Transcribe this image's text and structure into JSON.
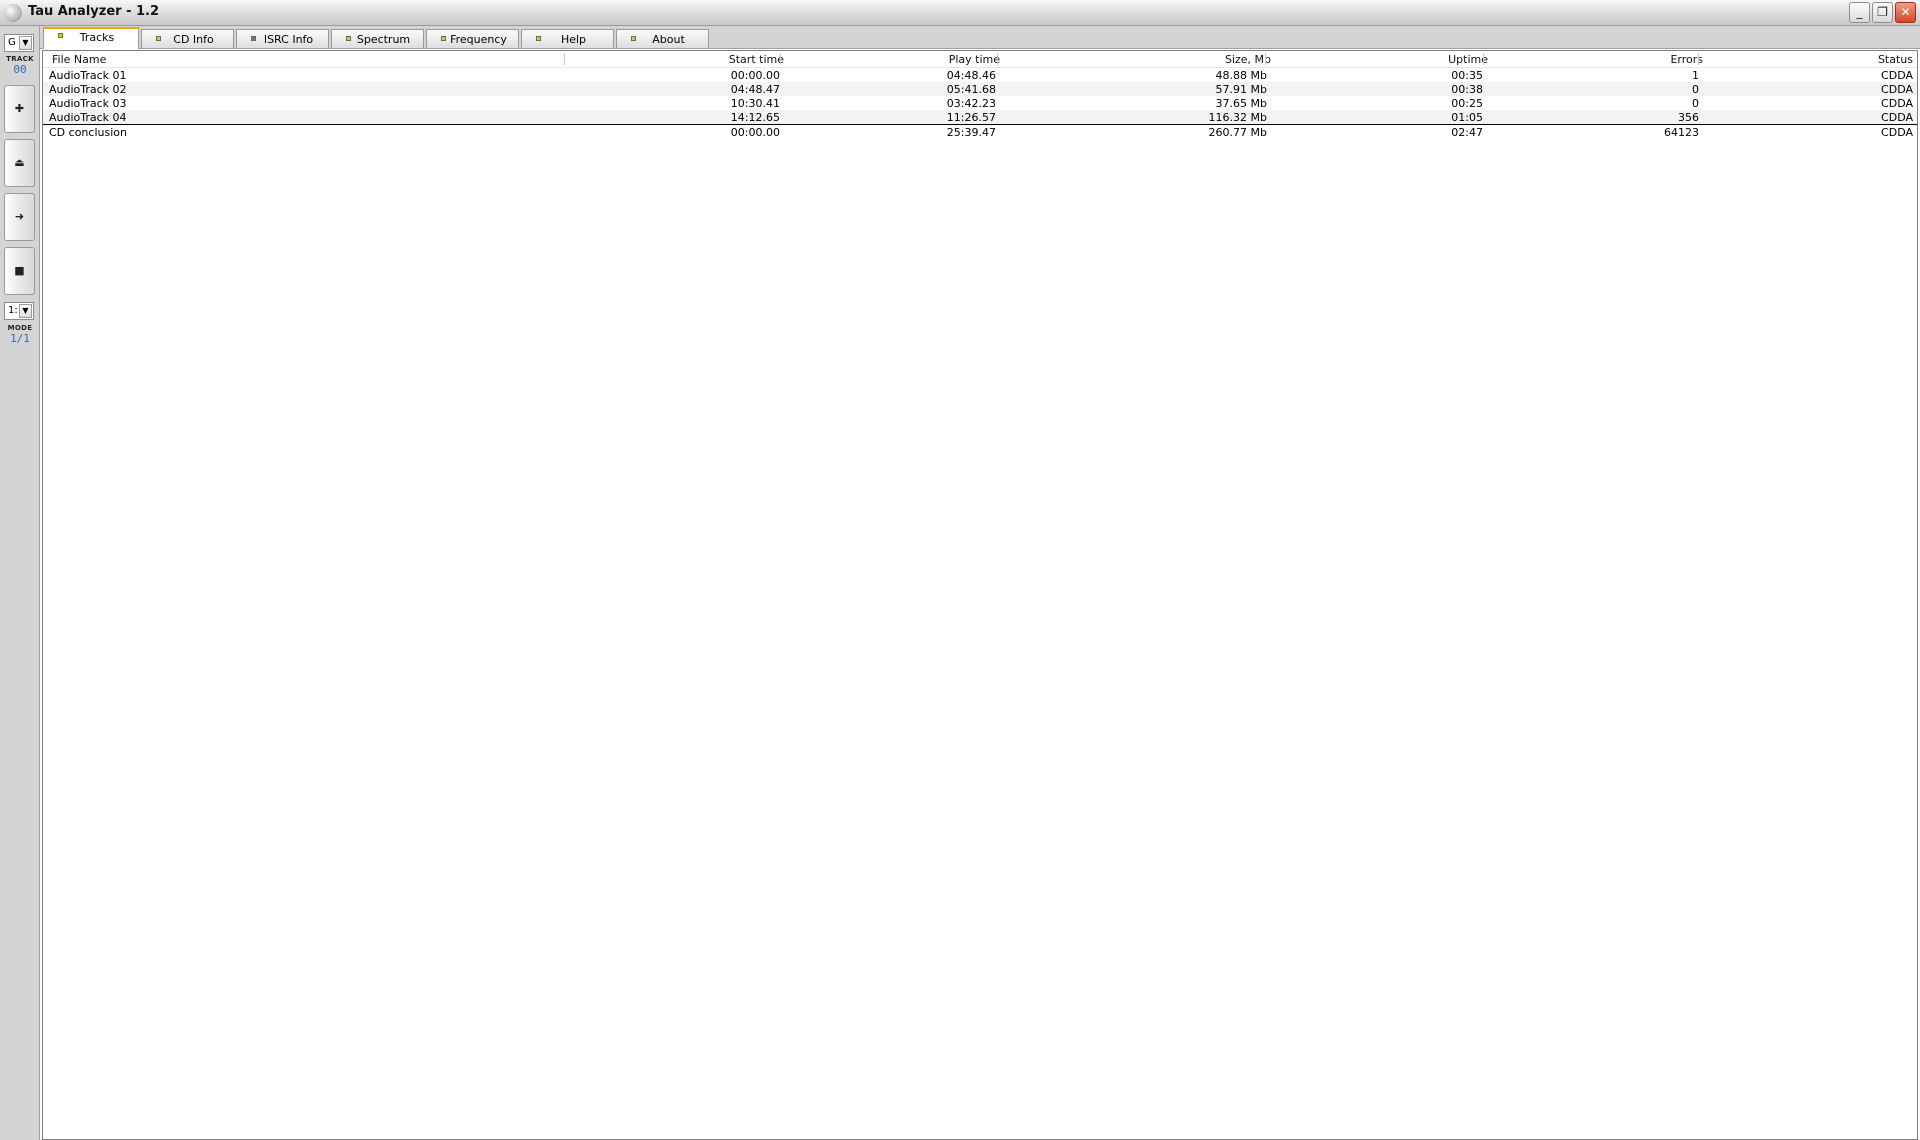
{
  "window": {
    "title": "Tau Analyzer - 1.2",
    "minimize_glyph": "_",
    "restore_glyph": "❐",
    "close_glyph": "✕"
  },
  "leftbar": {
    "drive_select": "G",
    "track_label": "TRACK",
    "track_value": "00",
    "btn_add_glyph": "✚",
    "btn_eject_glyph": "⏏",
    "btn_next_glyph": "➜",
    "btn_stop_glyph": "■",
    "speed_select": "1:",
    "mode_label": "MODE",
    "mode_value": "1/1"
  },
  "tabs": [
    {
      "label": "Tracks",
      "led": "green",
      "active": true
    },
    {
      "label": "CD Info",
      "led": "green",
      "active": false
    },
    {
      "label": "ISRC Info",
      "led": "gray",
      "active": false
    },
    {
      "label": "Spectrum",
      "led": "green",
      "active": false
    },
    {
      "label": "Frequency",
      "led": "green",
      "active": false
    },
    {
      "label": "Help",
      "led": "green",
      "active": false
    },
    {
      "label": "About",
      "led": "green",
      "active": false
    }
  ],
  "table": {
    "headers": {
      "file_name": "File Name",
      "start_time": "Start time",
      "play_time": "Play time",
      "size": "Size, Mb",
      "uptime": "Uptime",
      "errors": "Errors",
      "status": "Status"
    },
    "rows": [
      {
        "file_name": "AudioTrack 01",
        "start_time": "00:00.00",
        "play_time": "04:48.46",
        "size": "48.88 Mb",
        "uptime": "00:35",
        "errors": "1",
        "status": "CDDA"
      },
      {
        "file_name": "AudioTrack 02",
        "start_time": "04:48.47",
        "play_time": "05:41.68",
        "size": "57.91 Mb",
        "uptime": "00:38",
        "errors": "0",
        "status": "CDDA"
      },
      {
        "file_name": "AudioTrack 03",
        "start_time": "10:30.41",
        "play_time": "03:42.23",
        "size": "37.65 Mb",
        "uptime": "00:25",
        "errors": "0",
        "status": "CDDA"
      },
      {
        "file_name": "AudioTrack 04",
        "start_time": "14:12.65",
        "play_time": "11:26.57",
        "size": "116.32 Mb",
        "uptime": "01:05",
        "errors": "356",
        "status": "CDDA"
      }
    ],
    "total": {
      "file_name": "CD conclusion",
      "start_time": "00:00.00",
      "play_time": "25:39.47",
      "size": "260.77 Mb",
      "uptime": "02:47",
      "errors": "64123",
      "status": "CDDA"
    }
  }
}
